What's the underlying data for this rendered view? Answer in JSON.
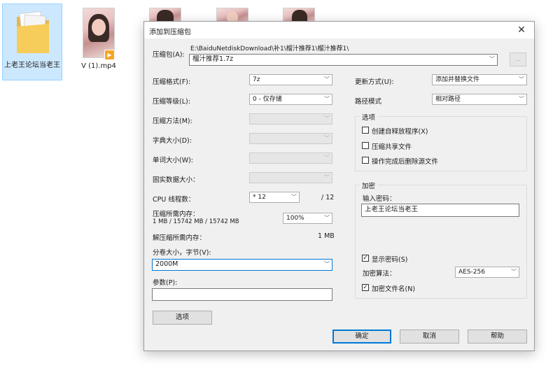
{
  "desktop": {
    "items": [
      {
        "label": "上老王论坛当老王"
      },
      {
        "label": "V (1).mp4"
      }
    ]
  },
  "dialog": {
    "title": "添加到压缩包",
    "close_glyph": "✕",
    "archive": {
      "label": "压缩包(A):",
      "path": "E:\\BaiduNetdiskDownload\\补1\\榴汁推荐1\\榴汁推荐1\\",
      "filename": "榴汁推荐1.7z",
      "browse_label": "..."
    },
    "left": {
      "format": {
        "label": "压缩格式(F):",
        "value": "7z"
      },
      "level": {
        "label": "压缩等级(L):",
        "value": "0 - 仅存储"
      },
      "method": {
        "label": "压缩方法(M):",
        "value": ""
      },
      "dict": {
        "label": "字典大小(D):",
        "value": ""
      },
      "word": {
        "label": "单词大小(W):",
        "value": ""
      },
      "solid": {
        "label": "固实数据大小：",
        "value": ""
      },
      "threads": {
        "label": "CPU 线程数：",
        "value": "* 12",
        "max": "/ 12"
      },
      "mem_compress": {
        "label": "压缩所需内存：",
        "detail": "1 MB / 15742 MB / 15742 MB",
        "percent": "100%"
      },
      "mem_decompress": {
        "label": "解压缩所需内存：",
        "value": "1 MB"
      },
      "volume": {
        "label": "分卷大小，字节(V):",
        "value": "2000M"
      },
      "params": {
        "label": "参数(P):",
        "value": ""
      },
      "options_button": "选项"
    },
    "right": {
      "update_mode": {
        "label": "更新方式(U):",
        "value": "添加并替换文件"
      },
      "path_mode": {
        "label": "路径模式",
        "value": "相对路径"
      },
      "options_group": {
        "title": "选项",
        "items": [
          {
            "label": "创建自释放程序(X)",
            "checked": false
          },
          {
            "label": "压缩共享文件",
            "checked": false
          },
          {
            "label": "操作完成后删除源文件",
            "checked": false
          }
        ]
      },
      "encryption_group": {
        "title": "加密",
        "password_label": "输入密码：",
        "password_value": "上老王论坛当老王",
        "show_password": {
          "label": "显示密码(S)",
          "checked": true
        },
        "method_label": "加密算法：",
        "method_value": "AES-256",
        "encrypt_names": {
          "label": "加密文件名(N)",
          "checked": true
        }
      }
    },
    "buttons": {
      "ok": "确定",
      "cancel": "取消",
      "help": "帮助"
    },
    "chevron_glyph": "﹀",
    "check_glyph": "✓"
  }
}
